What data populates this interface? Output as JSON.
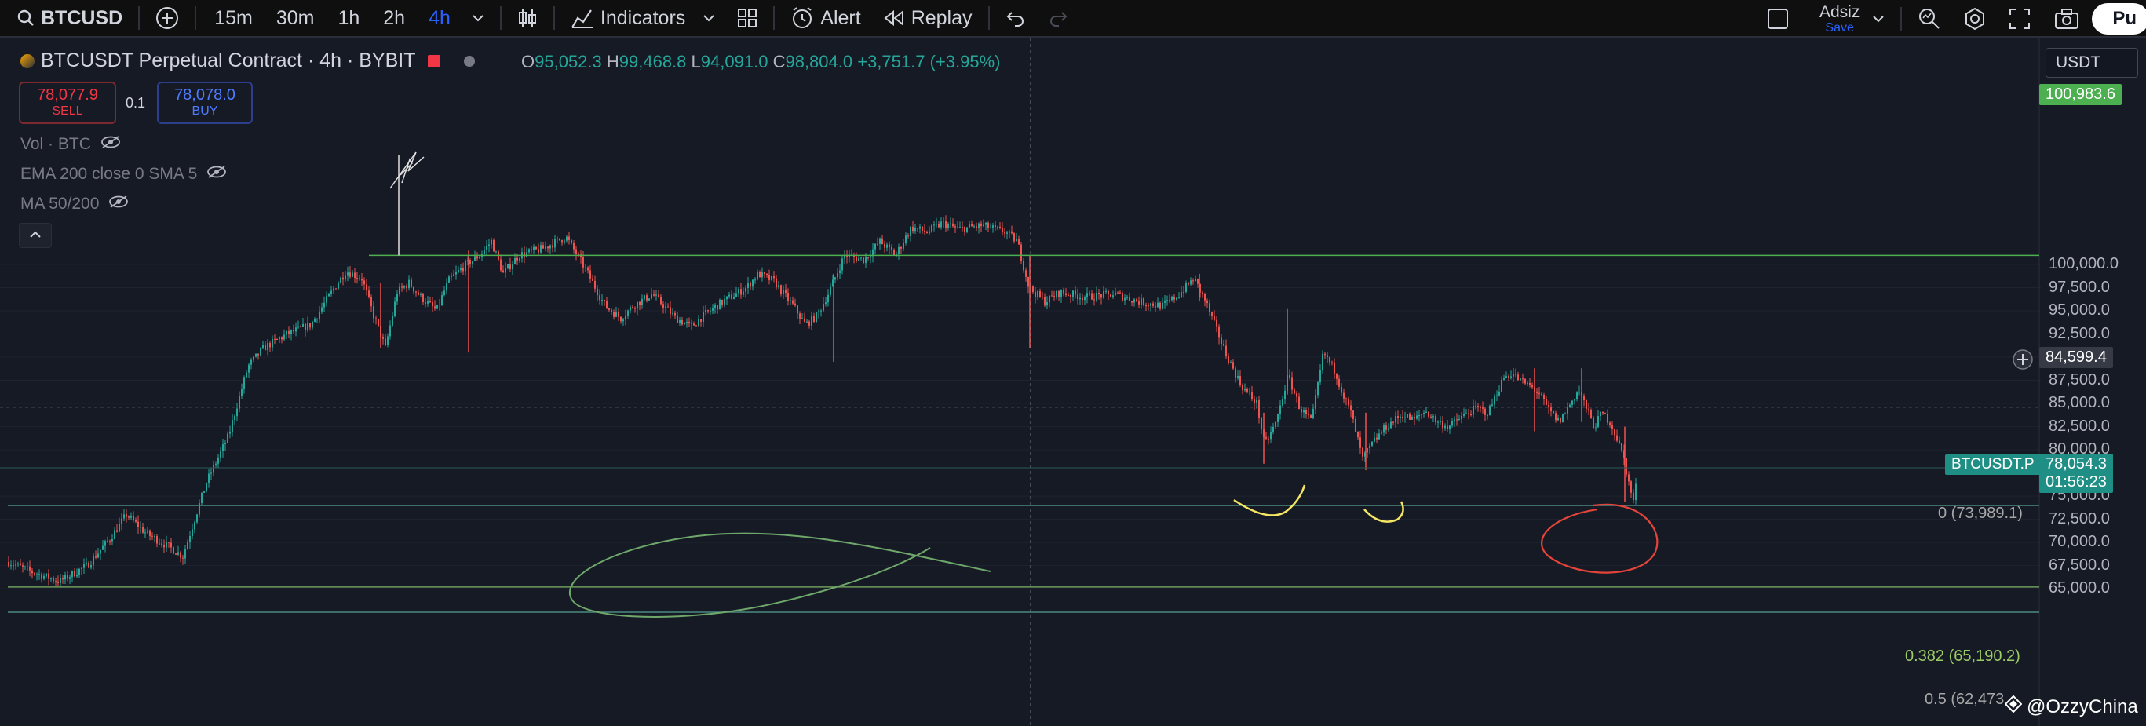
{
  "toolbar": {
    "symbol": "BTCUSD",
    "intervals": [
      {
        "label": "15m",
        "active": false
      },
      {
        "label": "30m",
        "active": false
      },
      {
        "label": "1h",
        "active": false
      },
      {
        "label": "2h",
        "active": false
      },
      {
        "label": "4h",
        "active": true
      }
    ],
    "indicators_label": "Indicators",
    "alert_label": "Alert",
    "replay_label": "Replay",
    "layout_name": "Adsiz",
    "save_label": "Save",
    "publish_label": "Pu"
  },
  "legend": {
    "title": "BTCUSDT Perpetual Contract · 4h · BYBIT",
    "o_key": "O",
    "o_val": "95,052.3",
    "h_key": "H",
    "h_val": "99,468.8",
    "l_key": "L",
    "l_val": "94,091.0",
    "c_key": "C",
    "c_val": "98,804.0",
    "change": "+3,751.7 (+3.95%)",
    "sell_price": "78,077.9",
    "sell_label": "SELL",
    "buy_price": "78,078.0",
    "buy_label": "BUY",
    "spread": "0.1",
    "indicators": [
      "Vol · BTC",
      "EMA 200 close 0 SMA 5",
      "MA 50/200"
    ]
  },
  "price_axis": {
    "currency": "USDT",
    "ticks": [
      "100,000.0",
      "97,500.0",
      "95,000.0",
      "92,500.0",
      "90,000.0",
      "87,500.0",
      "85,000.0",
      "82,500.0",
      "80,000.0",
      "75,000.0",
      "72,500.0",
      "70,000.0",
      "67,500.0",
      "65,000.0"
    ],
    "tick_values": [
      100000,
      97500,
      95000,
      92500,
      90000,
      87500,
      85000,
      82500,
      80000,
      75000,
      72500,
      70000,
      67500,
      65000
    ],
    "top_line_value": "100,983.6",
    "crosshair_value": "84,599.4",
    "symbol_tag": "BTCUSDT.P",
    "last_price": "78,054.3",
    "countdown": "01:56:23"
  },
  "fib_levels": [
    {
      "label": "0 (73,989.1)",
      "value": 73989.1
    },
    {
      "label": "0.382 (65,190.2)",
      "value": 65190.2
    },
    {
      "label": "0.5 (62,473",
      "value": 62473
    }
  ],
  "watermark": "@OzzyChina",
  "colors": {
    "background": "#161a25",
    "up": "#26a69a",
    "down": "#ef5350",
    "accent": "#2962ff",
    "line_green": "#4caf50",
    "fib_line": "#4a8a82",
    "drawing_yellow": "#f5e663",
    "drawing_red": "#e5443a",
    "drawing_green": "#6ea86a"
  },
  "icons": [
    "search-icon",
    "plus-circle-icon",
    "chevron-down-icon",
    "candles-icon",
    "indicators-icon",
    "templates-icon",
    "alert-icon",
    "replay-icon",
    "undo-icon",
    "redo-icon",
    "square-icon",
    "quick-search-icon",
    "settings-icon",
    "fullscreen-icon",
    "camera-icon",
    "eye-off-icon",
    "chevron-up-icon",
    "crosshair-plus-icon"
  ]
}
